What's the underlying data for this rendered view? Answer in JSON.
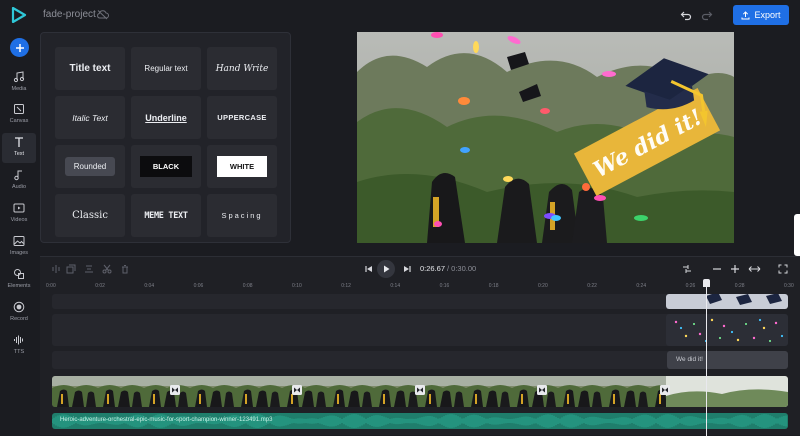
{
  "app": {
    "project_name": "fade-project",
    "export_label": "Export",
    "accent_color": "#1f6fe5"
  },
  "sidebar": {
    "items": [
      {
        "label": "Media",
        "icon": "media-icon"
      },
      {
        "label": "Canvas",
        "icon": "canvas-icon"
      },
      {
        "label": "Text",
        "icon": "text-icon",
        "active": true
      },
      {
        "label": "Audio",
        "icon": "audio-icon"
      },
      {
        "label": "Videos",
        "icon": "videos-icon"
      },
      {
        "label": "Images",
        "icon": "images-icon"
      },
      {
        "label": "Elements",
        "icon": "elements-icon"
      },
      {
        "label": "Record",
        "icon": "record-icon"
      },
      {
        "label": "TTS",
        "icon": "tts-icon"
      }
    ]
  },
  "text_styles": [
    {
      "label": "Title text",
      "style": "title"
    },
    {
      "label": "Regular text",
      "style": "regular"
    },
    {
      "label": "Hand Write",
      "style": "hand"
    },
    {
      "label": "Italic Text",
      "style": "italic"
    },
    {
      "label": "Underline",
      "style": "underline"
    },
    {
      "label": "UPPERCASE",
      "style": "upper"
    },
    {
      "label": "Rounded",
      "style": "rounded"
    },
    {
      "label": "BLACK",
      "style": "black"
    },
    {
      "label": "WHITE",
      "style": "white"
    },
    {
      "label": "Classic",
      "style": "classic"
    },
    {
      "label": "MEME TEXT",
      "style": "meme"
    },
    {
      "label": "Spacing",
      "style": "spacing"
    }
  ],
  "preview": {
    "banner_text": "We did it!"
  },
  "timeline": {
    "current_time": "0:26.67",
    "total_time": "/ 0:30.00",
    "ticks": [
      "0:00",
      "0:02",
      "0:04",
      "0:06",
      "0:08",
      "0:10",
      "0:12",
      "0:14",
      "0:16",
      "0:18",
      "0:20",
      "0:22",
      "0:24",
      "0:26",
      "0:28",
      "0:30"
    ],
    "text_clip_label": "We did it!",
    "audio_file": "Heroic-adventure-orchestral-epic-music-for-sport-champion-winner-123491.mp3"
  }
}
